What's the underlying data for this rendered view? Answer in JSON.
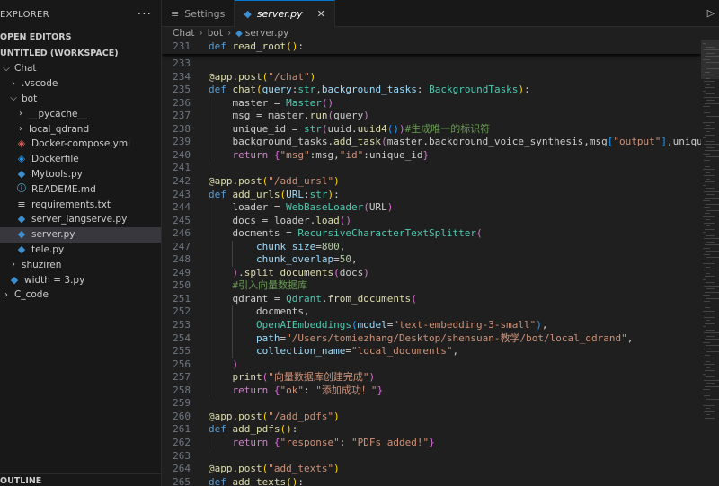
{
  "sidebar": {
    "title": "EXPLORER",
    "more_label": "···",
    "open_editors_label": "OPEN EDITORS",
    "workspace_label": "UNTITLED (WORKSPACE)",
    "items": [
      {
        "label": "Chat",
        "chevron": "⌵",
        "indent": 0,
        "icon": ""
      },
      {
        "label": ".vscode",
        "chevron": "›",
        "indent": 1,
        "icon": ""
      },
      {
        "label": "bot",
        "chevron": "⌵",
        "indent": 1,
        "icon": ""
      },
      {
        "label": "__pycache__",
        "chevron": "›",
        "indent": 2,
        "icon": ""
      },
      {
        "label": "local_qdrand",
        "chevron": "›",
        "indent": 2,
        "icon": ""
      },
      {
        "label": "Docker-compose.yml",
        "chevron": "",
        "indent": 2,
        "icon": "docker"
      },
      {
        "label": "Dockerfile",
        "chevron": "",
        "indent": 2,
        "icon": "docker2"
      },
      {
        "label": "Mytools.py",
        "chevron": "",
        "indent": 2,
        "icon": "py"
      },
      {
        "label": "READEME.md",
        "chevron": "",
        "indent": 2,
        "icon": "md"
      },
      {
        "label": "requirements.txt",
        "chevron": "",
        "indent": 2,
        "icon": "txt"
      },
      {
        "label": "server_langserve.py",
        "chevron": "",
        "indent": 2,
        "icon": "py"
      },
      {
        "label": "server.py",
        "chevron": "",
        "indent": 2,
        "icon": "py",
        "selected": true
      },
      {
        "label": "tele.py",
        "chevron": "",
        "indent": 2,
        "icon": "py"
      },
      {
        "label": "shuziren",
        "chevron": "›",
        "indent": 1,
        "icon": ""
      },
      {
        "label": "width = 3.py",
        "chevron": "",
        "indent": 1,
        "icon": "py"
      },
      {
        "label": "C_code",
        "chevron": "›",
        "indent": 0,
        "icon": ""
      }
    ],
    "outline_label": "OUTLINE"
  },
  "tabs": [
    {
      "label": "Settings",
      "icon": "≡",
      "active": false
    },
    {
      "label": "server.py",
      "icon": "◆",
      "active": true,
      "close": "✕"
    }
  ],
  "run_icon": "▷",
  "breadcrumb": [
    "Chat",
    "bot",
    "server.py"
  ],
  "editor": {
    "lines": [
      {
        "n": "231",
        "tokens": [
          [
            "kw",
            "def "
          ],
          [
            "fn",
            "read_root"
          ],
          [
            "b1",
            "()"
          ],
          [
            "pl",
            ":"
          ]
        ]
      },
      {
        "n": "233",
        "tokens": []
      },
      {
        "n": "234",
        "tokens": [
          [
            "dec",
            "@app.post"
          ],
          [
            "b1",
            "("
          ],
          [
            "str",
            "\"/chat\""
          ],
          [
            "b1",
            ")"
          ]
        ]
      },
      {
        "n": "235",
        "tokens": [
          [
            "kw",
            "def "
          ],
          [
            "fn",
            "chat"
          ],
          [
            "b1",
            "("
          ],
          [
            "param",
            "query"
          ],
          [
            "pl",
            ":"
          ],
          [
            "cls",
            "str"
          ],
          [
            "pl",
            ","
          ],
          [
            "param",
            "background_tasks"
          ],
          [
            "pl",
            ": "
          ],
          [
            "cls",
            "BackgroundTasks"
          ],
          [
            "b1",
            ")"
          ],
          [
            "pl",
            ":"
          ]
        ]
      },
      {
        "n": "236",
        "tokens": [
          [
            "pl",
            "    master = "
          ],
          [
            "cls",
            "Master"
          ],
          [
            "b2",
            "()"
          ]
        ]
      },
      {
        "n": "237",
        "tokens": [
          [
            "pl",
            "    msg = master."
          ],
          [
            "fn",
            "run"
          ],
          [
            "b2",
            "("
          ],
          [
            "pl",
            "query"
          ],
          [
            "b2",
            ")"
          ]
        ]
      },
      {
        "n": "238",
        "tokens": [
          [
            "pl",
            "    unique_id = "
          ],
          [
            "cls",
            "str"
          ],
          [
            "b2",
            "("
          ],
          [
            "pl",
            "uuid."
          ],
          [
            "fn",
            "uuid4"
          ],
          [
            "b3",
            "()"
          ],
          [
            "b2",
            ")"
          ],
          [
            "com",
            "#生成唯一的标识符"
          ]
        ]
      },
      {
        "n": "239",
        "tokens": [
          [
            "pl",
            "    background_tasks."
          ],
          [
            "fn",
            "add_task"
          ],
          [
            "b2",
            "("
          ],
          [
            "pl",
            "master.background_voice_synthesis,msg"
          ],
          [
            "b3",
            "["
          ],
          [
            "str",
            "\"output\""
          ],
          [
            "b3",
            "]"
          ],
          [
            "pl",
            ",unique_id"
          ],
          [
            "b2",
            ")"
          ]
        ]
      },
      {
        "n": "240",
        "tokens": [
          [
            "ctl",
            "    return "
          ],
          [
            "b2",
            "{"
          ],
          [
            "str",
            "\"msg\""
          ],
          [
            "pl",
            ":msg,"
          ],
          [
            "str",
            "\"id\""
          ],
          [
            "pl",
            ":unique_id"
          ],
          [
            "b2",
            "}"
          ]
        ]
      },
      {
        "n": "241",
        "tokens": []
      },
      {
        "n": "242",
        "tokens": [
          [
            "dec",
            "@app.post"
          ],
          [
            "b1",
            "("
          ],
          [
            "str",
            "\"/add_ursl\""
          ],
          [
            "b1",
            ")"
          ]
        ]
      },
      {
        "n": "243",
        "tokens": [
          [
            "kw",
            "def "
          ],
          [
            "fn",
            "add_urls"
          ],
          [
            "b1",
            "("
          ],
          [
            "param",
            "URL"
          ],
          [
            "pl",
            ":"
          ],
          [
            "cls",
            "str"
          ],
          [
            "b1",
            ")"
          ],
          [
            "pl",
            ":"
          ]
        ]
      },
      {
        "n": "244",
        "tokens": [
          [
            "pl",
            "    loader = "
          ],
          [
            "cls",
            "WebBaseLoader"
          ],
          [
            "b2",
            "("
          ],
          [
            "pl",
            "URL"
          ],
          [
            "b2",
            ")"
          ]
        ]
      },
      {
        "n": "245",
        "tokens": [
          [
            "pl",
            "    docs = loader."
          ],
          [
            "fn",
            "load"
          ],
          [
            "b2",
            "()"
          ]
        ]
      },
      {
        "n": "246",
        "tokens": [
          [
            "pl",
            "    docments = "
          ],
          [
            "cls",
            "RecursiveCharacterTextSplitter"
          ],
          [
            "b2",
            "("
          ]
        ]
      },
      {
        "n": "247",
        "tokens": [
          [
            "param",
            "        chunk_size"
          ],
          [
            "pl",
            "="
          ],
          [
            "num",
            "800"
          ],
          [
            "pl",
            ","
          ]
        ]
      },
      {
        "n": "248",
        "tokens": [
          [
            "param",
            "        chunk_overlap"
          ],
          [
            "pl",
            "="
          ],
          [
            "num",
            "50"
          ],
          [
            "pl",
            ","
          ]
        ]
      },
      {
        "n": "249",
        "tokens": [
          [
            "b2",
            "    )"
          ],
          [
            "pl",
            "."
          ],
          [
            "fn",
            "split_documents"
          ],
          [
            "b2",
            "("
          ],
          [
            "pl",
            "docs"
          ],
          [
            "b2",
            ")"
          ]
        ]
      },
      {
        "n": "250",
        "tokens": [
          [
            "com",
            "    #引入向量数据库"
          ]
        ]
      },
      {
        "n": "251",
        "tokens": [
          [
            "pl",
            "    qdrant = "
          ],
          [
            "cls",
            "Qdrant"
          ],
          [
            "pl",
            "."
          ],
          [
            "fn",
            "from_documents"
          ],
          [
            "b2",
            "("
          ]
        ]
      },
      {
        "n": "252",
        "tokens": [
          [
            "pl",
            "        docments,"
          ]
        ]
      },
      {
        "n": "253",
        "tokens": [
          [
            "pl",
            "        "
          ],
          [
            "cls",
            "OpenAIEmbeddings"
          ],
          [
            "b3",
            "("
          ],
          [
            "param",
            "model"
          ],
          [
            "pl",
            "="
          ],
          [
            "str",
            "\"text-embedding-3-small\""
          ],
          [
            "b3",
            ")"
          ],
          [
            "pl",
            ","
          ]
        ]
      },
      {
        "n": "254",
        "tokens": [
          [
            "param",
            "        path"
          ],
          [
            "pl",
            "="
          ],
          [
            "str",
            "\"/Users/tomiezhang/Desktop/shensuan-教学/bot/local_qdrand\""
          ],
          [
            "pl",
            ","
          ]
        ]
      },
      {
        "n": "255",
        "tokens": [
          [
            "param",
            "        collection_name"
          ],
          [
            "pl",
            "="
          ],
          [
            "str",
            "\"local_documents\""
          ],
          [
            "pl",
            ","
          ]
        ]
      },
      {
        "n": "256",
        "tokens": [
          [
            "b2",
            "    )"
          ]
        ]
      },
      {
        "n": "257",
        "tokens": [
          [
            "fn",
            "    print"
          ],
          [
            "b2",
            "("
          ],
          [
            "str",
            "\"向量数据库创建完成\""
          ],
          [
            "b2",
            ")"
          ]
        ]
      },
      {
        "n": "258",
        "tokens": [
          [
            "ctl",
            "    return "
          ],
          [
            "b2",
            "{"
          ],
          [
            "str",
            "\"ok\""
          ],
          [
            "pl",
            ": "
          ],
          [
            "str",
            "\"添加成功！\""
          ],
          [
            "b2",
            "}"
          ]
        ]
      },
      {
        "n": "259",
        "tokens": []
      },
      {
        "n": "260",
        "tokens": [
          [
            "dec",
            "@app.post"
          ],
          [
            "b1",
            "("
          ],
          [
            "str",
            "\"/add_pdfs\""
          ],
          [
            "b1",
            ")"
          ]
        ]
      },
      {
        "n": "261",
        "tokens": [
          [
            "kw",
            "def "
          ],
          [
            "fn",
            "add_pdfs"
          ],
          [
            "b1",
            "()"
          ],
          [
            "pl",
            ":"
          ]
        ]
      },
      {
        "n": "262",
        "tokens": [
          [
            "ctl",
            "    return "
          ],
          [
            "b2",
            "{"
          ],
          [
            "str",
            "\"response\""
          ],
          [
            "pl",
            ": "
          ],
          [
            "str",
            "\"PDFs added!\""
          ],
          [
            "b2",
            "}"
          ]
        ]
      },
      {
        "n": "263",
        "tokens": []
      },
      {
        "n": "264",
        "tokens": [
          [
            "dec",
            "@app.post"
          ],
          [
            "b1",
            "("
          ],
          [
            "str",
            "\"add_texts\""
          ],
          [
            "b1",
            ")"
          ]
        ]
      },
      {
        "n": "265",
        "tokens": [
          [
            "kw",
            "def "
          ],
          [
            "fn",
            "add_texts"
          ],
          [
            "b1",
            "()"
          ],
          [
            "pl",
            ":"
          ]
        ]
      }
    ]
  },
  "colors": {
    "accent": "#0078d4",
    "keyword": "#569cd6",
    "function": "#dcdcaa",
    "string": "#ce9178",
    "class": "#4ec9b0",
    "comment": "#6a9955"
  }
}
